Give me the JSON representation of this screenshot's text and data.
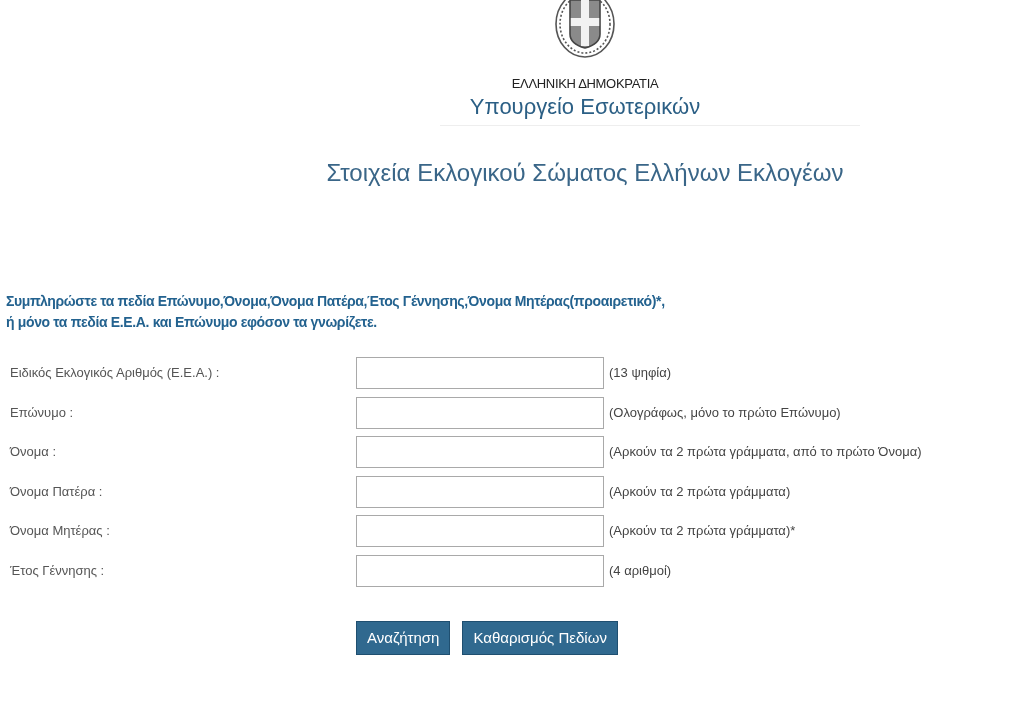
{
  "header": {
    "country": "ΕΛΛΗΝΙΚΗ ΔΗΜΟΚΡΑΤΙΑ",
    "ministry": "Υπουργείο Εσωτερικών"
  },
  "page_title": "Στοιχεία Εκλογικού Σώματος Ελλήνων Εκλογέων",
  "instructions": [
    "Συμπληρώστε τα πεδία Επώνυμο,Όνομα,Όνομα Πατέρα,Έτος Γέννησης,Όνομα Μητέρας(προαιρετικό)*,",
    "ή μόνο τα πεδία Ε.Ε.Α. και Επώνυμο εφόσον τα γνωρίζετε."
  ],
  "fields": [
    {
      "label": "Ειδικός Εκλογικός Αριθμός (Ε.Ε.Α.) :",
      "hint": "(13 ψηφία)"
    },
    {
      "label": "Επώνυμο :",
      "hint": "(Ολογράφως, μόνο το πρώτο Επώνυμο)"
    },
    {
      "label": "Όνομα :",
      "hint": "(Αρκούν τα 2 πρώτα γράμματα, από το πρώτο Όνομα)"
    },
    {
      "label": "Όνομα Πατέρα :",
      "hint": "(Αρκούν τα 2 πρώτα γράμματα)"
    },
    {
      "label": "Όνομα Μητέρας :",
      "hint": "(Αρκούν τα 2 πρώτα γράμματα)*"
    },
    {
      "label": "Έτος Γέννησης :",
      "hint": "(4 αριθμοί)"
    }
  ],
  "buttons": [
    "Αναζήτηση",
    "Καθαρισμός Πεδίων"
  ]
}
